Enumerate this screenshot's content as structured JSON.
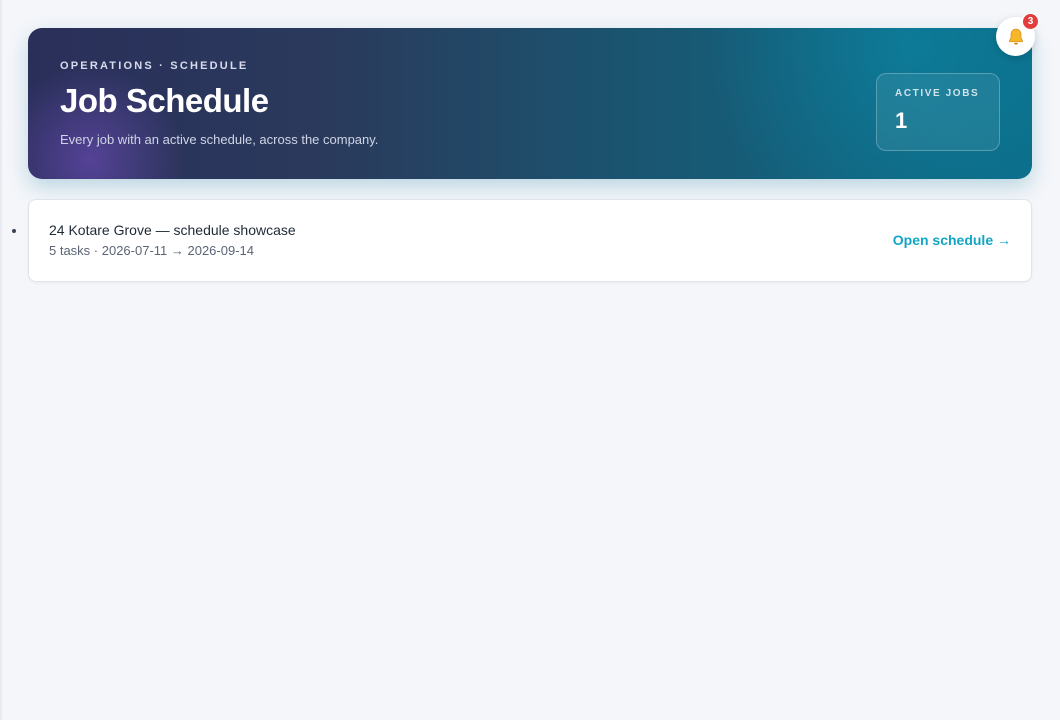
{
  "header": {
    "eyebrow": "OPERATIONS · SCHEDULE",
    "title": "Job Schedule",
    "subtitle": "Every job with an active schedule, across the company.",
    "stat": {
      "label": "ACTIVE JOBS",
      "value": "1"
    }
  },
  "notifications": {
    "icon": "bell-icon",
    "count": "3"
  },
  "jobs": [
    {
      "title": "24 Kotare Grove — schedule showcase",
      "meta": "5 tasks · 2026-07-11 → 2026-09-14",
      "link_label": "Open schedule →"
    }
  ],
  "colors": {
    "accent": "#12a6c4",
    "badge": "#e23c3c",
    "background": "#f4f6fa"
  }
}
